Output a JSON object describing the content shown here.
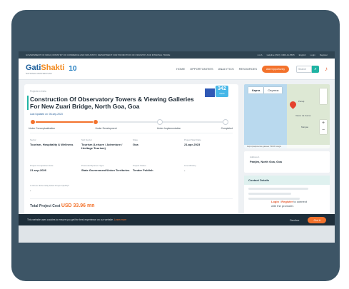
{
  "gov_strip": {
    "left": "GOVERNMENT OF INDIA | MINISTRY OF COMMERCE AND INDUSTRY | DEPARTMENT FOR PROMOTION OF INDUSTRY AND INTERNAL TRADE",
    "text_size": "A A A",
    "helpline": "Helpline (IND): 1800-11-5565",
    "language": "English",
    "login": "Login",
    "register": "Register"
  },
  "header": {
    "logo_gati": "Gati",
    "logo_shakti": "Shakti",
    "logo_tagline": "NATIONAL MASTER PLAN",
    "logo_ten": "10",
    "nav": [
      "HOME",
      "OPPORTUNITIES",
      "ANALYTICS",
      "RESOURCES"
    ],
    "post_button": "Add Opportunity",
    "search_placeholder": "Search",
    "search_icon": "search-icon",
    "bell_icon": "bell-icon"
  },
  "project": {
    "breadcrumb": "Projects in India",
    "title": "Construction Of Observatory Towers & Viewing Galleries For New Zuari Bridge, North Goa, Goa",
    "updated": "Last Updated on: 06-sep-2023",
    "views_count": "342",
    "views_label": "Views",
    "stages": [
      "Under Conceptualization",
      "Under Development",
      "Under Implementation",
      "Completed"
    ],
    "stage_progress": 0.33,
    "fields_row1": [
      {
        "k": "Sector",
        "v": "Tourism, Hospitality & Wellness"
      },
      {
        "k": "Sub Sector",
        "v": "Tourism (Leisure / Adventure / Heritage Tourism)"
      },
      {
        "k": "State",
        "v": "Goa"
      },
      {
        "k": "Project Start Date",
        "v": "21-apr-2023"
      }
    ],
    "fields_row2": [
      {
        "k": "Project Completion Date",
        "v": "21-sep-2026"
      },
      {
        "k": "Promoter/Sponsor Type",
        "v": "State Government/Union Territories"
      },
      {
        "k": "Project Status",
        "v": "Tender Publish"
      },
      {
        "k": "Line Ministry",
        "v": "-"
      }
    ],
    "external_key": "Is this an Externally Aided Project (EAP)?",
    "external_value": "-",
    "cost_label": "Total Project Cost",
    "cost_value": "USD 33.96 mn"
  },
  "map": {
    "tab_map": "Карта",
    "tab_sat": "Спутник",
    "cities": [
      "Panaji",
      "Vasco da Gama",
      "Margao"
    ],
    "zoom_in": "+",
    "zoom_out": "−",
    "footer": "Картографические данные ©2023 Google"
  },
  "address": {
    "label": "Address 1",
    "value": "Panjim, North Goa, Goa"
  },
  "contact": {
    "title": "Contact Details",
    "login": "Login",
    "sep": " / ",
    "register": "Register",
    "tail1": " to connect",
    "tail2": "with the promoter."
  },
  "cookie": {
    "message": "This website uses cookies to ensure you get the best experience on our website.",
    "learn_more": "Learn more",
    "decline": "Decline",
    "ok": "Got it"
  },
  "colors": {
    "accent": "#f3722c",
    "teal": "#1fb3a3",
    "frame": "#3d5566"
  }
}
